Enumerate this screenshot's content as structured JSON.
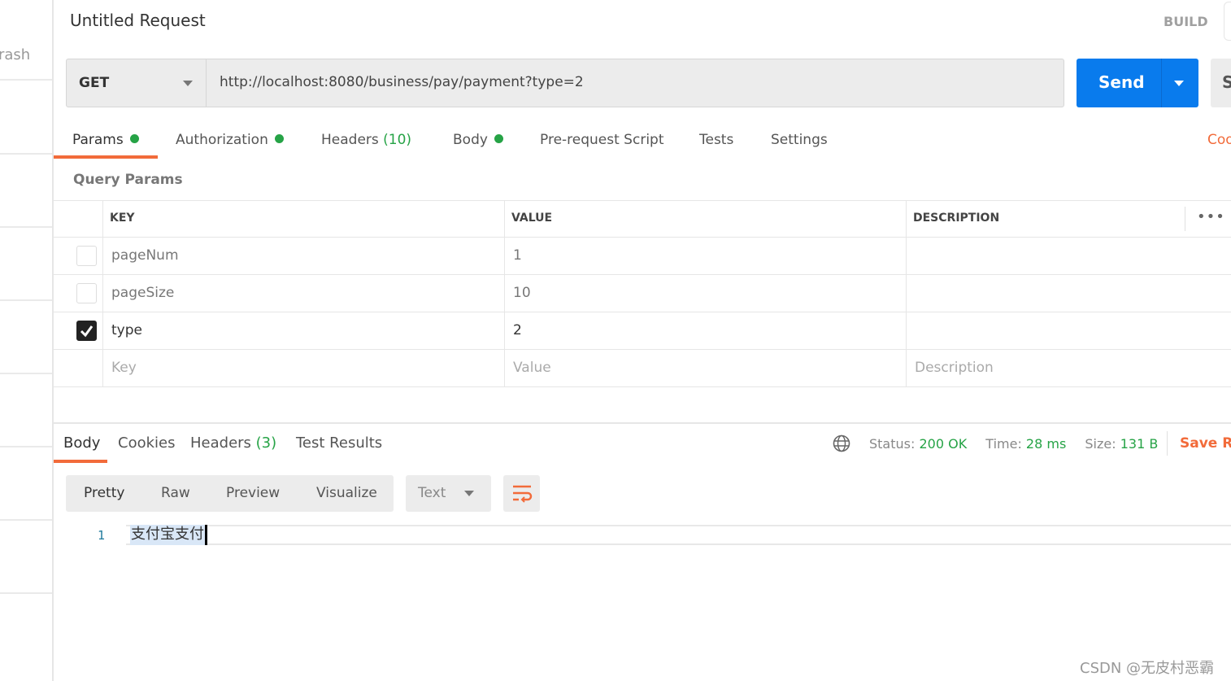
{
  "sidebar": {
    "partial_label": "rash"
  },
  "header": {
    "title": "Untitled Request",
    "build_label": "BUILD"
  },
  "request": {
    "method": "GET",
    "url": "http://localhost:8080/business/pay/payment?type=2",
    "send_label": "Send",
    "save_partial": "S"
  },
  "tabs": [
    {
      "label": "Params",
      "dot": true,
      "active": true
    },
    {
      "label": "Authorization",
      "dot": true
    },
    {
      "label": "Headers",
      "count": "(10)"
    },
    {
      "label": "Body",
      "dot": true
    },
    {
      "label": "Pre-request Script"
    },
    {
      "label": "Tests"
    },
    {
      "label": "Settings"
    }
  ],
  "code_link_partial": "Coo",
  "params": {
    "section_title": "Query Params",
    "columns": [
      "KEY",
      "VALUE",
      "DESCRIPTION"
    ],
    "rows": [
      {
        "key": "pageNum",
        "value": "1",
        "description": "",
        "checked": false
      },
      {
        "key": "pageSize",
        "value": "10",
        "description": "",
        "checked": false
      },
      {
        "key": "type",
        "value": "2",
        "description": "",
        "checked": true
      }
    ],
    "placeholders": {
      "key": "Key",
      "value": "Value",
      "description": "Description"
    }
  },
  "response": {
    "tabs": [
      {
        "label": "Body",
        "active": true
      },
      {
        "label": "Cookies"
      },
      {
        "label": "Headers",
        "count": "(3)"
      },
      {
        "label": "Test Results"
      }
    ],
    "status_label": "Status:",
    "status": "200 OK",
    "time_label": "Time:",
    "time": "28 ms",
    "size_label": "Size:",
    "size": "131 B",
    "save_partial": "Save Re",
    "views": [
      "Pretty",
      "Raw",
      "Preview",
      "Visualize"
    ],
    "format": "Text",
    "lines": [
      {
        "num": "1",
        "text": "支付宝支付"
      }
    ]
  },
  "watermark": "CSDN @无皮村恶霸",
  "colors": {
    "accent": "#f26b3a",
    "send": "#097bed",
    "green": "#26a346"
  }
}
